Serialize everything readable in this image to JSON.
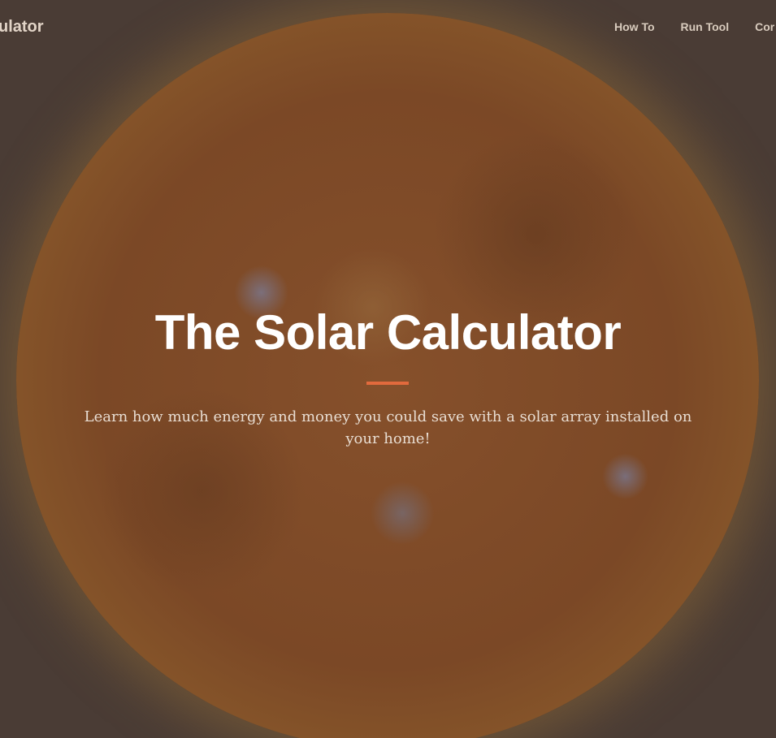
{
  "navbar": {
    "brand": "ulator",
    "links": [
      "How To",
      "Run Tool",
      "Cor"
    ]
  },
  "hero": {
    "title": "The Solar Calculator",
    "subtitle": "Learn how much energy and money you could save with a solar array installed on your  home!",
    "accent_color": "#e26a3d"
  }
}
